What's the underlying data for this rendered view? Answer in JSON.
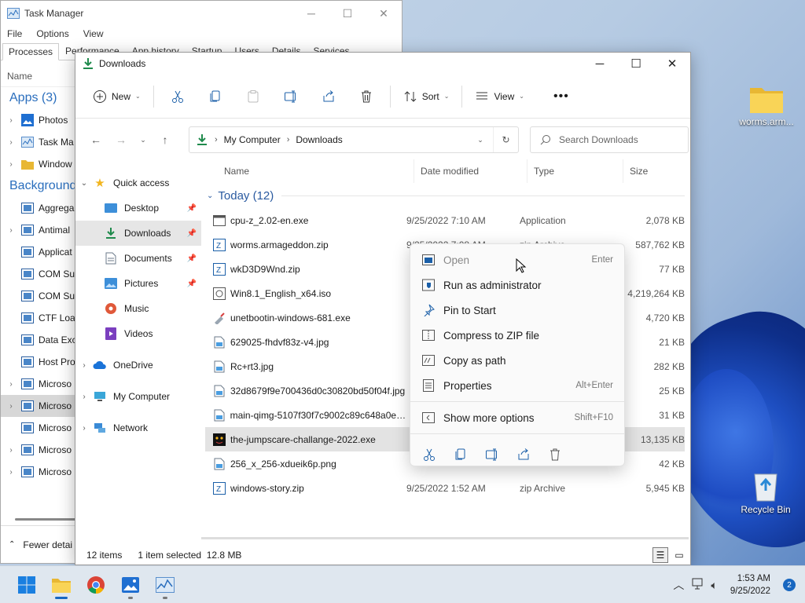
{
  "desktop": {
    "icons": [
      {
        "label": "worms.arm..."
      },
      {
        "label": "Recycle Bin"
      }
    ]
  },
  "task_manager": {
    "title": "Task Manager",
    "menu": [
      "File",
      "Options",
      "View"
    ],
    "tabs": [
      "Processes",
      "Performance",
      "App history",
      "Startup",
      "Users",
      "Details",
      "Services"
    ],
    "column_name": "Name",
    "groups": {
      "apps": "Apps (3)",
      "background": "Background"
    },
    "apps": [
      "Photos",
      "Task Ma",
      "Window"
    ],
    "background": [
      "Aggrega",
      "Antimal",
      "Applicat",
      "COM Su",
      "COM Su",
      "CTF Loa",
      "Data Exc",
      "Host Pro",
      "Microso",
      "Microso",
      "Microso",
      "Microso",
      "Microso"
    ],
    "footer": "Fewer detai"
  },
  "explorer": {
    "title": "Downloads",
    "toolbar": {
      "new": "New",
      "sort": "Sort",
      "view": "View"
    },
    "address": {
      "root": "My Computer",
      "current": "Downloads"
    },
    "search_placeholder": "Search Downloads",
    "nav_pane": {
      "quick_access": "Quick access",
      "items": [
        "Desktop",
        "Downloads",
        "Documents",
        "Pictures",
        "Music",
        "Videos"
      ],
      "onedrive": "OneDrive",
      "my_computer": "My Computer",
      "network": "Network"
    },
    "columns": {
      "name": "Name",
      "date": "Date modified",
      "type": "Type",
      "size": "Size"
    },
    "group": "Today (12)",
    "files": [
      {
        "name": "cpu-z_2.02-en.exe",
        "date": "9/25/2022 7:10 AM",
        "type": "Application",
        "size": "2,078 KB"
      },
      {
        "name": "worms.armageddon.zip",
        "date": "9/25/2022 7:08 AM",
        "type": "zip Archive",
        "size": "587,762 KB"
      },
      {
        "name": "wkD3D9Wnd.zip",
        "date": "",
        "type": "",
        "size": "77 KB"
      },
      {
        "name": "Win8.1_English_x64.iso",
        "date": "",
        "type": "",
        "size": "4,219,264 KB"
      },
      {
        "name": "unetbootin-windows-681.exe",
        "date": "",
        "type": "",
        "size": "4,720 KB"
      },
      {
        "name": "629025-fhdvf83z-v4.jpg",
        "date": "",
        "type": "",
        "size": "21 KB"
      },
      {
        "name": "Rc+rt3.jpg",
        "date": "",
        "type": "",
        "size": "282 KB"
      },
      {
        "name": "32d8679f9e700436d0c30820bd50f04f.jpg",
        "date": "",
        "type": "",
        "size": "25 KB"
      },
      {
        "name": "main-qimg-5107f30f7c9002c89c648a0e6…",
        "date": "",
        "type": "",
        "size": "31 KB"
      },
      {
        "name": "the-jumpscare-challange-2022.exe",
        "date": "",
        "type": "",
        "size": "13,135 KB"
      },
      {
        "name": "256_x_256-xdueik6p.png",
        "date": "",
        "type": "",
        "size": "42 KB"
      },
      {
        "name": "windows-story.zip",
        "date": "9/25/2022 1:52 AM",
        "type": "zip Archive",
        "size": "5,945 KB"
      }
    ],
    "status": {
      "count": "12 items",
      "selected": "1 item selected",
      "size": "12.8 MB"
    }
  },
  "context_menu": {
    "items": [
      {
        "label": "Open",
        "shortcut": "Enter"
      },
      {
        "label": "Run as administrator",
        "shortcut": ""
      },
      {
        "label": "Pin to Start",
        "shortcut": ""
      },
      {
        "label": "Compress to ZIP file",
        "shortcut": ""
      },
      {
        "label": "Copy as path",
        "shortcut": ""
      },
      {
        "label": "Properties",
        "shortcut": "Alt+Enter"
      }
    ],
    "more": {
      "label": "Show more options",
      "shortcut": "Shift+F10"
    }
  },
  "taskbar": {
    "time": "1:53 AM",
    "date": "9/25/2022",
    "notifications": "2"
  }
}
